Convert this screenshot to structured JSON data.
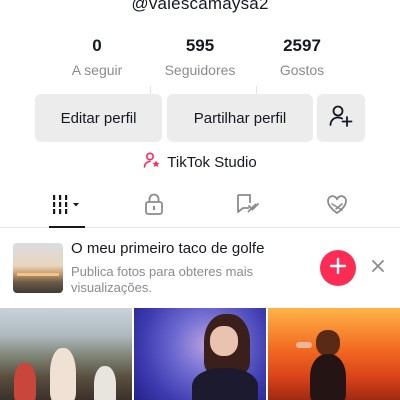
{
  "profile": {
    "username": "@valescamaysa2",
    "stats": [
      {
        "value": "0",
        "label": "A seguir"
      },
      {
        "value": "595",
        "label": "Seguidores"
      },
      {
        "value": "2597",
        "label": "Gostos"
      }
    ]
  },
  "actions": {
    "edit_label": "Editar perfil",
    "share_label": "Partilhar perfil",
    "add_friend_icon": "add-user-icon"
  },
  "studio": {
    "label": "TikTok Studio",
    "icon": "studio-person-star-icon",
    "icon_color": "#fe2c55"
  },
  "tabs": [
    {
      "name": "videos-grid",
      "icon": "grid-icon",
      "active": true
    },
    {
      "name": "private",
      "icon": "lock-icon",
      "active": false
    },
    {
      "name": "reposts",
      "icon": "repost-icon",
      "active": false
    },
    {
      "name": "liked",
      "icon": "liked-heart-icon",
      "active": false
    }
  ],
  "banner": {
    "title": "O meu primeiro taco de golfe",
    "subtitle": "Publica fotos para obteres mais visualizações.",
    "add_icon": "plus-icon",
    "close_icon": "close-icon",
    "accent": "#fe2c55"
  },
  "videos": [
    {
      "name": "video-thumb-1"
    },
    {
      "name": "video-thumb-2"
    },
    {
      "name": "video-thumb-3"
    }
  ]
}
